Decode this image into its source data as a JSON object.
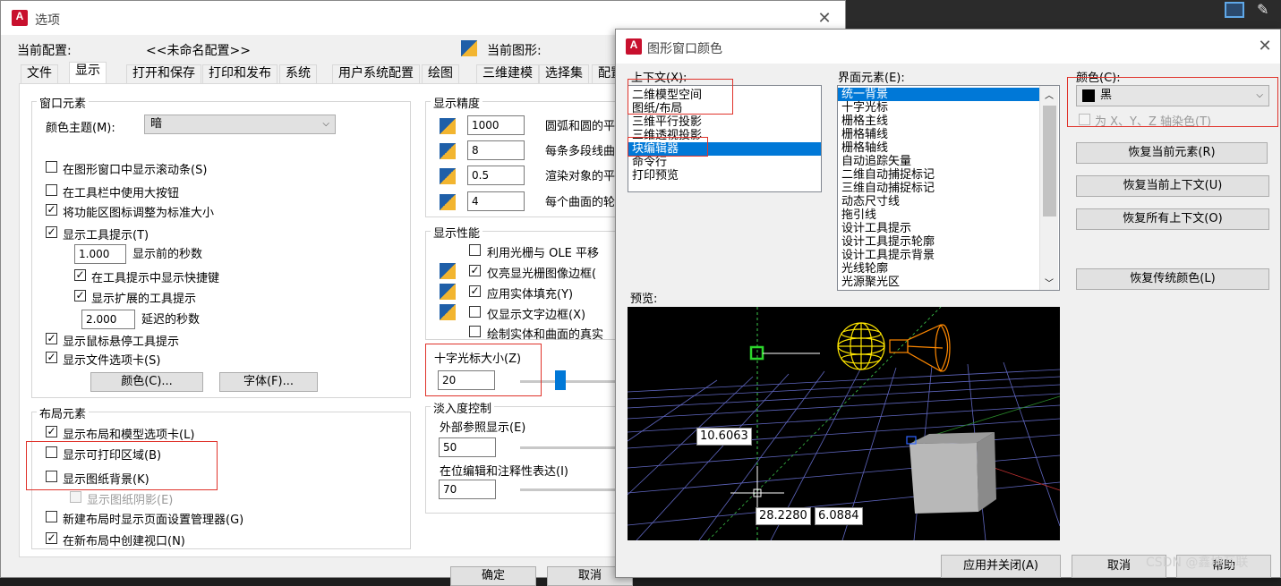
{
  "colors": {
    "accent": "#0078d7",
    "highlight_box": "#e0332b",
    "dark_bg": "#1e1e1e"
  },
  "options_window": {
    "title": "选项",
    "logo_text": "A",
    "current_profile_label": "当前配置:",
    "current_profile_value": "<<未命名配置>>",
    "current_drawing_label": "当前图形:",
    "tabs": [
      "文件",
      "显示",
      "打开和保存",
      "打印和发布",
      "系统",
      "用户系统配置",
      "绘图",
      "三维建模",
      "选择集",
      "配置"
    ],
    "window_elements": {
      "title": "窗口元素",
      "color_theme_label": "颜色主题(M):",
      "color_theme_value": "暗",
      "scrollbars": "在图形窗口中显示滚动条(S)",
      "large_buttons": "在工具栏中使用大按钮",
      "resize_ribbon": "将功能区图标调整为标准大小",
      "show_tooltips": "显示工具提示(T)",
      "tooltip_seconds_value": "1.000",
      "tooltip_seconds_label": "显示前的秒数",
      "show_shortcuts": "在工具提示中显示快捷键",
      "extended_tooltips": "显示扩展的工具提示",
      "delay_value": "2.000",
      "delay_label": "延迟的秒数",
      "rollover": "显示鼠标悬停工具提示",
      "file_tabs": "显示文件选项卡(S)",
      "colors_button": "颜色(C)...",
      "fonts_button": "字体(F)..."
    },
    "layout_elements": {
      "title": "布局元素",
      "layout_model_tabs": "显示布局和模型选项卡(L)",
      "printable_area": "显示可打印区域(B)",
      "paper_background": "显示图纸背景(K)",
      "paper_shadow": "显示图纸阴影(E)",
      "page_setup_manager": "新建布局时显示页面设置管理器(G)",
      "create_viewport": "在新布局中创建视口(N)"
    },
    "display_resolution": {
      "title": "显示精度",
      "rows": [
        {
          "value": "1000",
          "label": "圆弧和圆的平"
        },
        {
          "value": "8",
          "label": "每条多段线曲"
        },
        {
          "value": "0.5",
          "label": "渲染对象的平"
        },
        {
          "value": "4",
          "label": "每个曲面的轮"
        }
      ]
    },
    "display_performance": {
      "title": "显示性能",
      "items": [
        "利用光栅与 OLE 平移",
        "仅亮显光栅图像边框(",
        "应用实体填充(Y)",
        "仅显示文字边框(X)",
        "绘制实体和曲面的真实"
      ]
    },
    "crosshair": {
      "title": "十字光标大小(Z)",
      "value": "20",
      "level_percent": 20
    },
    "fade_control": {
      "title": "淡入度控制",
      "xref_label": "外部参照显示(E)",
      "xref_value": "50",
      "inplace_label": "在位编辑和注释性表达(I)",
      "inplace_value": "70"
    },
    "footer": {
      "ok": "确定",
      "cancel": "取消"
    }
  },
  "color_dialog": {
    "title": "图形窗口颜色",
    "logo_text": "A",
    "context_label": "上下文(X):",
    "context_items": [
      "二维模型空间",
      "图纸/布局",
      "三维平行投影",
      "三维透视投影",
      "块编辑器",
      "命令行",
      "打印预览"
    ],
    "context_selected_index": 4,
    "interface_label": "界面元素(E):",
    "interface_items": [
      "统一背景",
      "十字光标",
      "栅格主线",
      "栅格辅线",
      "栅格轴线",
      "自动追踪矢量",
      "二维自动捕捉标记",
      "三维自动捕捉标记",
      "动态尺寸线",
      "拖引线",
      "设计工具提示",
      "设计工具提示轮廓",
      "设计工具提示背景",
      "光线轮廓",
      "光源聚光区"
    ],
    "interface_selected_index": 0,
    "color_label": "颜色(C):",
    "color_value": "黑",
    "color_swatch": "#000000",
    "tint_label": "为 X、Y、Z 轴染色(T)",
    "restore_element": "恢复当前元素(R)",
    "restore_context": "恢复当前上下文(U)",
    "restore_all": "恢复所有上下文(O)",
    "restore_classic": "恢复传统颜色(L)",
    "preview_label": "预览:",
    "preview_values": {
      "dim_a": "10.6063",
      "coord_x": "28.2280",
      "coord_y": "6.0884"
    },
    "apply_close": "应用并关闭(A)",
    "cancel": "取消",
    "help": "帮助"
  },
  "watermark": "CSDN @鑫坤互联"
}
